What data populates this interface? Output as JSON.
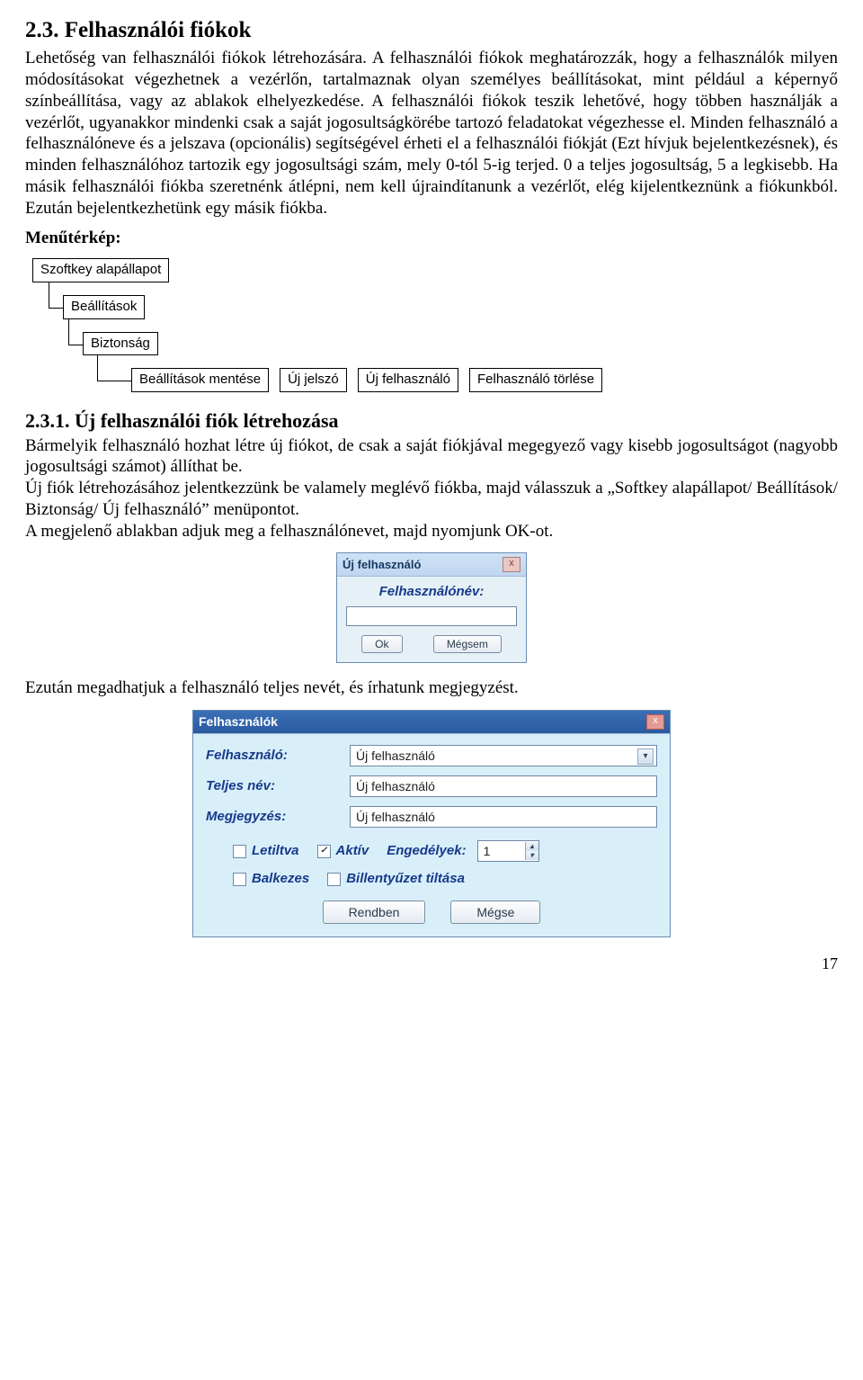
{
  "section": {
    "number": "2.3.",
    "title": "Felhasználói fiókok"
  },
  "intro": "Lehetőség van felhasználói fiókok létrehozására. A felhasználói fiókok meghatározzák, hogy a felhasználók milyen módosításokat végezhetnek a vezérlőn, tartalmaznak olyan személyes beállításokat, mint például a képernyő színbeállítása, vagy az ablakok elhelyezkedése. A felhasználói fiókok teszik lehetővé, hogy többen használják a vezérlőt, ugyanakkor mindenki csak a saját jogosultságkörébe tartozó feladatokat végezhesse el. Minden felhasználó a felhasználóneve és a jelszava (opcionális) segítségével érheti el a felhasználói fiókját (Ezt hívjuk bejelentkezésnek), és minden felhasználóhoz tartozik egy jogosultsági szám, mely 0-tól 5-ig terjed. 0 a teljes jogosultság, 5 a legkisebb. Ha másik felhasználói fiókba szeretnénk átlépni, nem kell újraindítanunk a vezérlőt, elég kijelentkeznünk a fiókunkból. Ezután bejelentkezhetünk egy másik fiókba.",
  "menumap_label": "Menűtérkép:",
  "tree": {
    "l1": "Szoftkey alapállapot",
    "l2": "Beállítások",
    "l3": "Biztonság",
    "l4": [
      "Beállítások mentése",
      "Új jelszó",
      "Új felhasználó",
      "Felhasználó törlése"
    ]
  },
  "subsection": {
    "number": "2.3.1.",
    "title": "Új felhasználói fiók létrehozása"
  },
  "subsection_body": "Bármelyik felhasználó hozhat létre új fiókot, de csak a saját fiókjával megegyező vagy kisebb jogosultságot (nagyobb jogosultsági számot) állíthat be.\nÚj fiók létrehozásához jelentkezzünk be valamely meglévő fiókba, majd válasszuk a „Softkey alapállapot/ Beállítások/ Biztonság/ Új felhasználó” menüpontot.\nA megjelenő ablakban adjuk meg a felhasználónevet, majd nyomjunk OK-ot.",
  "dialog1": {
    "title": "Új felhasználó",
    "close": "x",
    "label": "Felhasználónév:",
    "value": "",
    "ok": "Ok",
    "cancel": "Mégsem"
  },
  "after_dlg1": "Ezután megadhatjuk a felhasználó teljes nevét, és írhatunk megjegyzést.",
  "dialog2": {
    "title": "Felhasználók",
    "close": "x",
    "rows": [
      {
        "label": "Felhasználó:",
        "value": "Új felhasználó",
        "dropdown": true
      },
      {
        "label": "Teljes név:",
        "value": "Új felhasználó",
        "dropdown": false
      },
      {
        "label": "Megjegyzés:",
        "value": "Új felhasználó",
        "dropdown": false
      }
    ],
    "checks": {
      "letiltva": {
        "label": "Letiltva",
        "checked": false
      },
      "aktiv": {
        "label": "Aktív",
        "checked": true
      },
      "engedelyek": {
        "label": "Engedélyek:",
        "value": "1"
      },
      "balkezes": {
        "label": "Balkezes",
        "checked": false
      },
      "billentyuzet": {
        "label": "Billentyűzet tiltása",
        "checked": false
      }
    },
    "ok": "Rendben",
    "cancel": "Mégse"
  },
  "page_number": "17"
}
